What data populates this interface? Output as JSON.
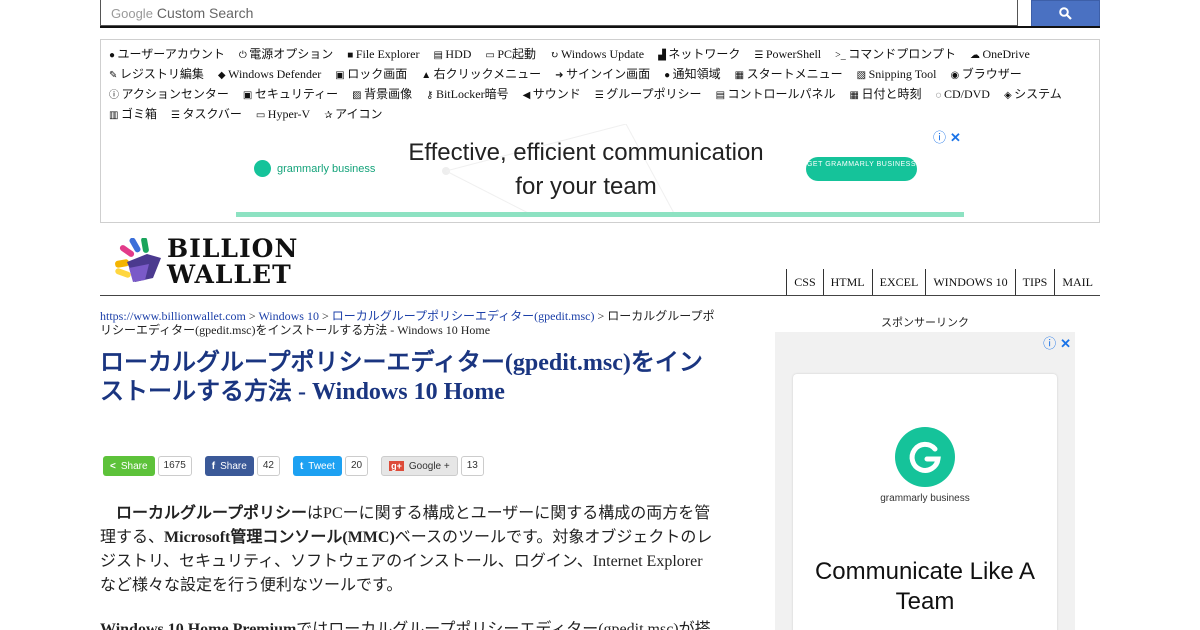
{
  "search": {
    "brand": "Google",
    "placeholder": "Custom Search"
  },
  "links": [
    {
      "icon": "user-circle-icon",
      "label": "ユーザーアカウント"
    },
    {
      "icon": "power-icon",
      "label": "電源オプション"
    },
    {
      "icon": "folder-icon",
      "label": "File Explorer"
    },
    {
      "icon": "database-icon",
      "label": "HDD"
    },
    {
      "icon": "laptop-icon",
      "label": "PC起動"
    },
    {
      "icon": "refresh-icon",
      "label": "Windows Update"
    },
    {
      "icon": "signal-icon",
      "label": "ネットワーク"
    },
    {
      "icon": "list-icon",
      "label": "PowerShell"
    },
    {
      "icon": "terminal-icon",
      "label": "コマンドプロンプト"
    },
    {
      "icon": "cloud-icon",
      "label": "OneDrive"
    },
    {
      "icon": "edit-icon",
      "label": "レジストリ編集"
    },
    {
      "icon": "shield-icon",
      "label": "Windows Defender"
    },
    {
      "icon": "lock-icon",
      "label": "ロック画面"
    },
    {
      "icon": "cursor-icon",
      "label": "右クリックメニュー"
    },
    {
      "icon": "sign-in-icon",
      "label": "サインイン画面"
    },
    {
      "icon": "comment-icon",
      "label": "通知領域"
    },
    {
      "icon": "windows-icon",
      "label": "スタートメニュー"
    },
    {
      "icon": "copy-icon",
      "label": "Snipping Tool"
    },
    {
      "icon": "globe-icon",
      "label": "ブラウザー"
    },
    {
      "icon": "info-icon",
      "label": "アクションセンター"
    },
    {
      "icon": "lock-icon",
      "label": "セキュリティー"
    },
    {
      "icon": "image-icon",
      "label": "背景画像"
    },
    {
      "icon": "key-icon",
      "label": "BitLocker暗号"
    },
    {
      "icon": "volume-icon",
      "label": "サウンド"
    },
    {
      "icon": "list-icon",
      "label": "グループポリシー"
    },
    {
      "icon": "id-card-icon",
      "label": "コントロールパネル"
    },
    {
      "icon": "calendar-icon",
      "label": "日付と時刻"
    },
    {
      "icon": "disc-icon",
      "label": "CD/DVD"
    },
    {
      "icon": "cube-icon",
      "label": "システム"
    },
    {
      "icon": "trash-icon",
      "label": "ゴミ箱"
    },
    {
      "icon": "taskbar-icon",
      "label": "タスクバー"
    },
    {
      "icon": "monitor-icon",
      "label": "Hyper-V"
    },
    {
      "icon": "star-icon",
      "label": "アイコン"
    }
  ],
  "ad_top": {
    "brand": "grammarly business",
    "message": "Effective, efficient communication for your team",
    "cta": "GET GRAMMARLY BUSINESS"
  },
  "logo": {
    "line1": "BILLION",
    "line2": "WALLET"
  },
  "nav": [
    "CSS",
    "HTML",
    "EXCEL",
    "WINDOWS 10",
    "TIPS",
    "MAIL"
  ],
  "breadcrumb": {
    "home": "https://www.billionwallet.com",
    "sep": " > ",
    "cat": "Windows 10",
    "sub": "ローカルグループポリシーエディター(gpedit.msc)",
    "current": "ローカルグループポリシーエディター(gpedit.msc)をインストールする方法 - Windows 10 Home"
  },
  "title": "ローカルグループポリシーエディター(gpedit.msc)をインストールする方法 - Windows 10 Home",
  "shares": [
    {
      "icon": "share-icon",
      "label": "Share",
      "count": "1675",
      "color": "#5dc23a"
    },
    {
      "icon": "facebook-icon",
      "label": "Share",
      "count": "42",
      "color": "#3b5998"
    },
    {
      "icon": "twitter-icon",
      "label": "Tweet",
      "count": "20",
      "color": "#1da1f2"
    },
    {
      "icon": "google-plus-icon",
      "label": "Google +",
      "count": "13",
      "color": "#e6e6e6"
    }
  ],
  "body": {
    "p1_bold1": "ローカルグループポリシー",
    "p1_text1": "はPCーに関する構成とユーザーに関する構成の両方を管理する、",
    "p1_bold2": "Microsoft管理コンソール(MMC)",
    "p1_text2": "ベースのツールです。対象オブジェクトのレジストリ、セキュリティ、ソフトウェアのインストール、ログイン、Internet Explorerなど様々な設定を行う便利なツールです。",
    "p2_bold": "Windows 10 Home Premium",
    "p2_text": "ではローカルグループポリシーエディター(gpedit.msc)が搭"
  },
  "sidebar": {
    "sponsored": "スポンサーリンク",
    "ad_brand": "grammarly business",
    "ad_headline": "Communicate Like A Team"
  },
  "colors": {
    "link": "#1b3fa8",
    "title": "#1a3580",
    "grammarly": "#15c39a",
    "search_button": "#4a71c2"
  }
}
